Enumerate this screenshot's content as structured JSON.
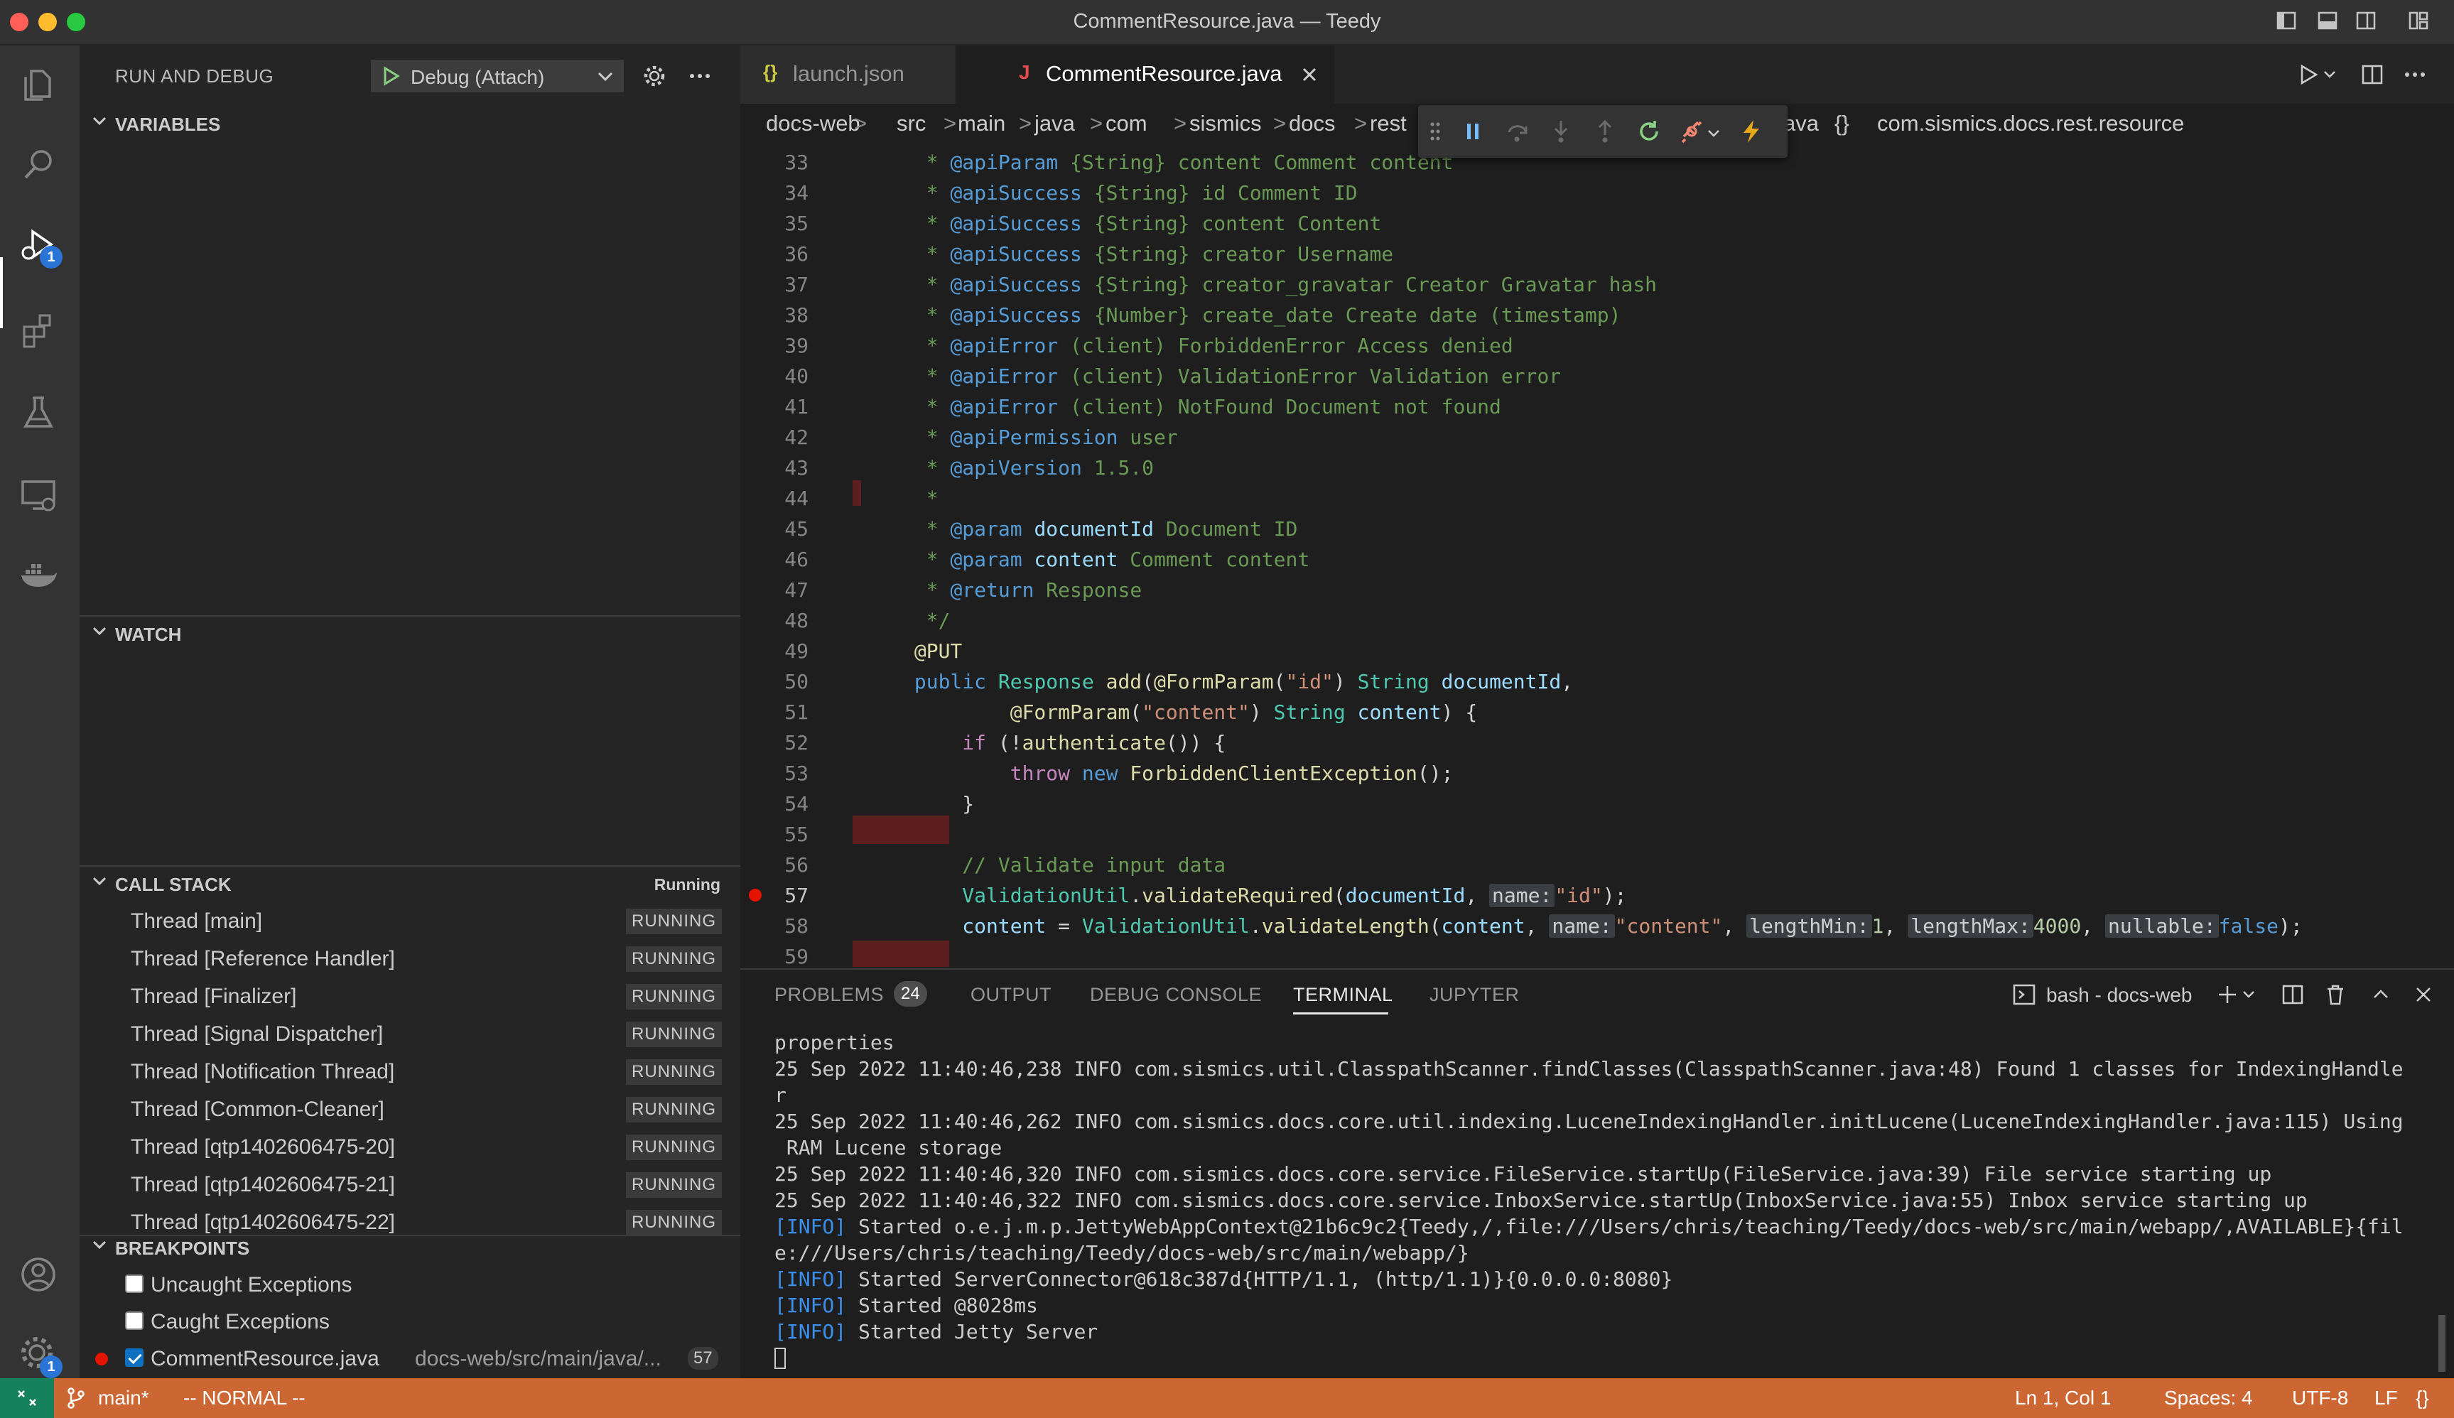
{
  "window": {
    "title": "CommentResource.java — Teedy"
  },
  "activity_bar": {
    "items": [
      {
        "icon": "explorer-icon"
      },
      {
        "icon": "search-icon"
      },
      {
        "icon": "run-debug-icon",
        "badge": "1"
      },
      {
        "icon": "extensions-icon"
      },
      {
        "icon": "testing-icon"
      },
      {
        "icon": "remote-explorer-icon"
      },
      {
        "icon": "docker-icon"
      }
    ],
    "bottom": [
      {
        "icon": "accounts-icon"
      },
      {
        "icon": "manage-gear-icon",
        "badge": "1"
      }
    ]
  },
  "sidebar": {
    "title": "RUN AND DEBUG",
    "config_name": "Debug (Attach)",
    "sections": {
      "variables": "VARIABLES",
      "watch": "WATCH",
      "call_stack": "CALL STACK",
      "call_stack_status": "Running",
      "breakpoints": "BREAKPOINTS"
    },
    "threads": [
      {
        "name": "Thread [main]",
        "status": "RUNNING"
      },
      {
        "name": "Thread [Reference Handler]",
        "status": "RUNNING"
      },
      {
        "name": "Thread [Finalizer]",
        "status": "RUNNING"
      },
      {
        "name": "Thread [Signal Dispatcher]",
        "status": "RUNNING"
      },
      {
        "name": "Thread [Notification Thread]",
        "status": "RUNNING"
      },
      {
        "name": "Thread [Common-Cleaner]",
        "status": "RUNNING"
      },
      {
        "name": "Thread [qtp1402606475-20]",
        "status": "RUNNING"
      },
      {
        "name": "Thread [qtp1402606475-21]",
        "status": "RUNNING"
      },
      {
        "name": "Thread [qtp1402606475-22]",
        "status": "RUNNING"
      }
    ],
    "breakpoints": [
      {
        "label": "Uncaught Exceptions",
        "checked": false
      },
      {
        "label": "Caught Exceptions",
        "checked": false
      },
      {
        "label": "CommentResource.java",
        "path": "docs-web/src/main/java/...",
        "line": "57",
        "checked": true
      }
    ]
  },
  "editor": {
    "tabs": [
      {
        "label": "launch.json",
        "icon_text": "{}",
        "active": false
      },
      {
        "label": "CommentResource.java",
        "icon_text": "J",
        "active": true
      }
    ],
    "breadcrumb": [
      "docs-web",
      "src",
      "main",
      "java",
      "com",
      "sismics",
      "docs",
      "rest"
    ],
    "breadcrumb_tail_prefix": "ava",
    "breadcrumb_tail": "com.sismics.docs.rest.resource",
    "first_line_text": "* @apiParam {String} content Comment content",
    "lines": {
      "n33": "33",
      "n34": "34",
      "n35": "35",
      "n36": "36",
      "n37": "37",
      "n38": "38",
      "n39": "39",
      "n40": "40",
      "n41": "41",
      "n42": "42",
      "n43": "43",
      "n44": "44",
      "n45": "45",
      "n46": "46",
      "n47": "47",
      "n48": "48",
      "n49": "49",
      "n50": "50",
      "n51": "51",
      "n52": "52",
      "n53": "53",
      "n54": "54",
      "n55": "55",
      "n56": "56",
      "n57": "57",
      "n58": "58",
      "n59": "59"
    },
    "breakpoint_line": "57"
  },
  "panel": {
    "tabs": [
      {
        "label": "PROBLEMS",
        "badge": "24"
      },
      {
        "label": "OUTPUT"
      },
      {
        "label": "DEBUG CONSOLE"
      },
      {
        "label": "TERMINAL",
        "active": true
      },
      {
        "label": "JUPYTER"
      }
    ],
    "terminal_name": "bash - docs-web",
    "terminal_lines": [
      "properties",
      "25 Sep 2022 11:40:46,238 INFO com.sismics.util.ClasspathScanner.findClasses(ClasspathScanner.java:48) Found 1 classes for IndexingHandle",
      "r",
      "25 Sep 2022 11:40:46,262 INFO com.sismics.docs.core.util.indexing.LuceneIndexingHandler.initLucene(LuceneIndexingHandler.java:115) Using",
      " RAM Lucene storage",
      "25 Sep 2022 11:40:46,320 INFO com.sismics.docs.core.service.FileService.startUp(FileService.java:39) File service starting up",
      "25 Sep 2022 11:40:46,322 INFO com.sismics.docs.core.service.InboxService.startUp(InboxService.java:55) Inbox service starting up"
    ],
    "info_lines": [
      {
        "tag": "[INFO]",
        "text": " Started o.e.j.m.p.JettyWebAppContext@21b6c9c2{Teedy,/,file:///Users/chris/teaching/Teedy/docs-web/src/main/webapp/,AVAILABLE}{fil"
      },
      {
        "tag": "",
        "text": "e:///Users/chris/teaching/Teedy/docs-web/src/main/webapp/}"
      },
      {
        "tag": "[INFO]",
        "text": " Started ServerConnector@618c387d{HTTP/1.1, (http/1.1)}{0.0.0.0:8080}"
      },
      {
        "tag": "[INFO]",
        "text": " Started @8028ms"
      },
      {
        "tag": "[INFO]",
        "text": " Started Jetty Server"
      }
    ]
  },
  "statusbar": {
    "branch": "main*",
    "mode": "-- NORMAL --",
    "position": "Ln 1, Col 1",
    "spaces": "Spaces: 4",
    "encoding": "UTF-8",
    "eol": "LF",
    "language_icon_text": "{}"
  },
  "colors": {
    "statusbar": "#cc6633",
    "accent": "#2a74d6",
    "breakpoint": "#e51400"
  }
}
